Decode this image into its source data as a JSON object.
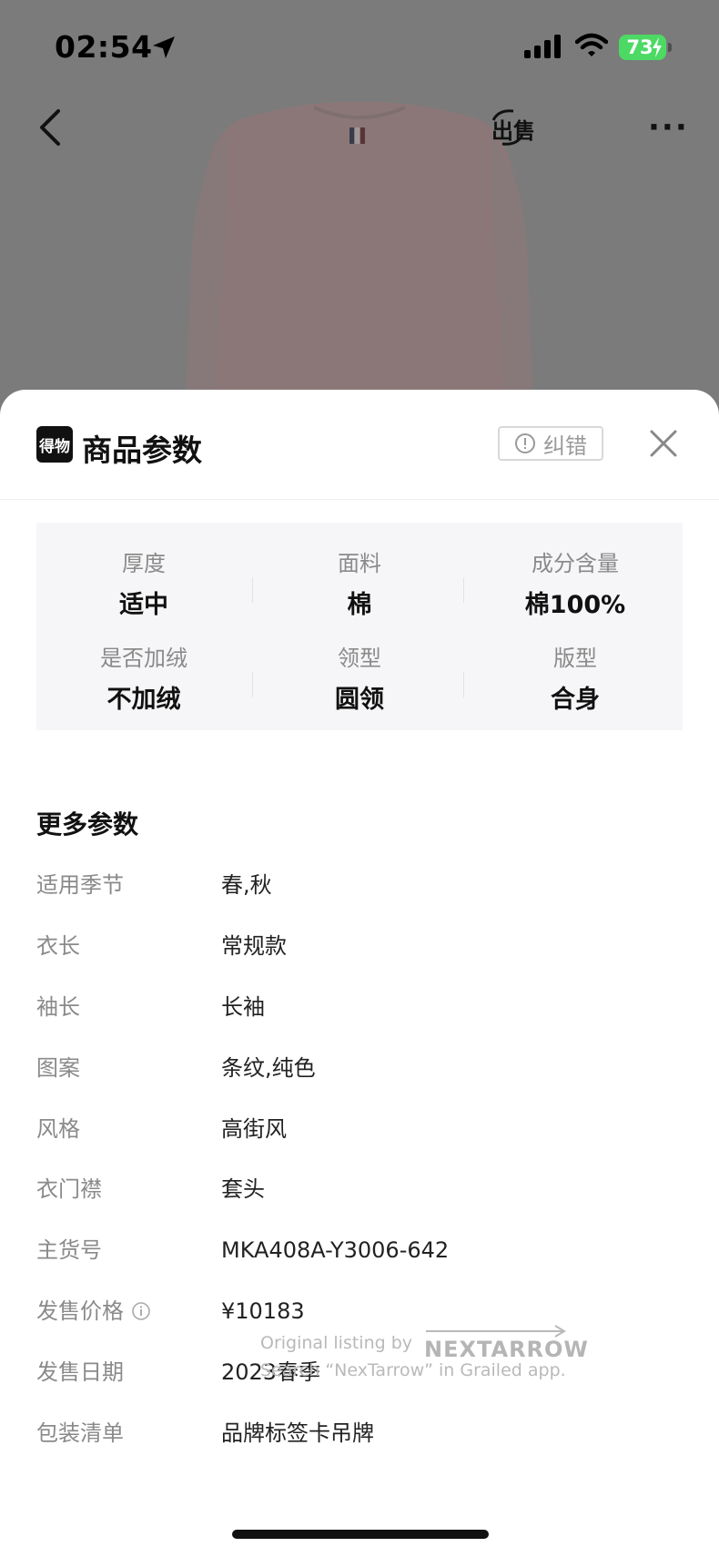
{
  "status_bar": {
    "time": "02:54",
    "battery": "73"
  },
  "nav": {
    "sell_label": "出售"
  },
  "sheet": {
    "brand_logo_text": "得物",
    "title": "商品参数",
    "report_label": "纠错"
  },
  "specs": [
    {
      "label": "厚度",
      "value": "适中"
    },
    {
      "label": "面料",
      "value": "棉"
    },
    {
      "label": "成分含量",
      "value": "棉100%"
    },
    {
      "label": "是否加绒",
      "value": "不加绒"
    },
    {
      "label": "领型",
      "value": "圆领"
    },
    {
      "label": "版型",
      "value": "合身"
    }
  ],
  "more_params": {
    "title": "更多参数",
    "rows": [
      {
        "label": "适用季节",
        "value": "春,秋"
      },
      {
        "label": "衣长",
        "value": "常规款"
      },
      {
        "label": "袖长",
        "value": "长袖"
      },
      {
        "label": "图案",
        "value": "条纹,纯色"
      },
      {
        "label": "风格",
        "value": "高街风"
      },
      {
        "label": "衣门襟",
        "value": "套头"
      },
      {
        "label": "主货号",
        "value": "MKA408A-Y3006-642"
      },
      {
        "label": "发售价格",
        "value": "¥10183"
      },
      {
        "label": "发售日期",
        "value": "2023春季"
      },
      {
        "label": "包装清单",
        "value": "品牌标签卡吊牌"
      }
    ]
  },
  "watermark": {
    "line1": "Original listing by",
    "brand": "NEXTARROW",
    "line2": "Search “NexTarrow” in Grailed app."
  },
  "colors": {
    "battery": "#4cd964",
    "sheet_bg": "#ffffff",
    "spec_card_bg": "#f6f6f8",
    "muted_text": "#8a8a8a"
  }
}
